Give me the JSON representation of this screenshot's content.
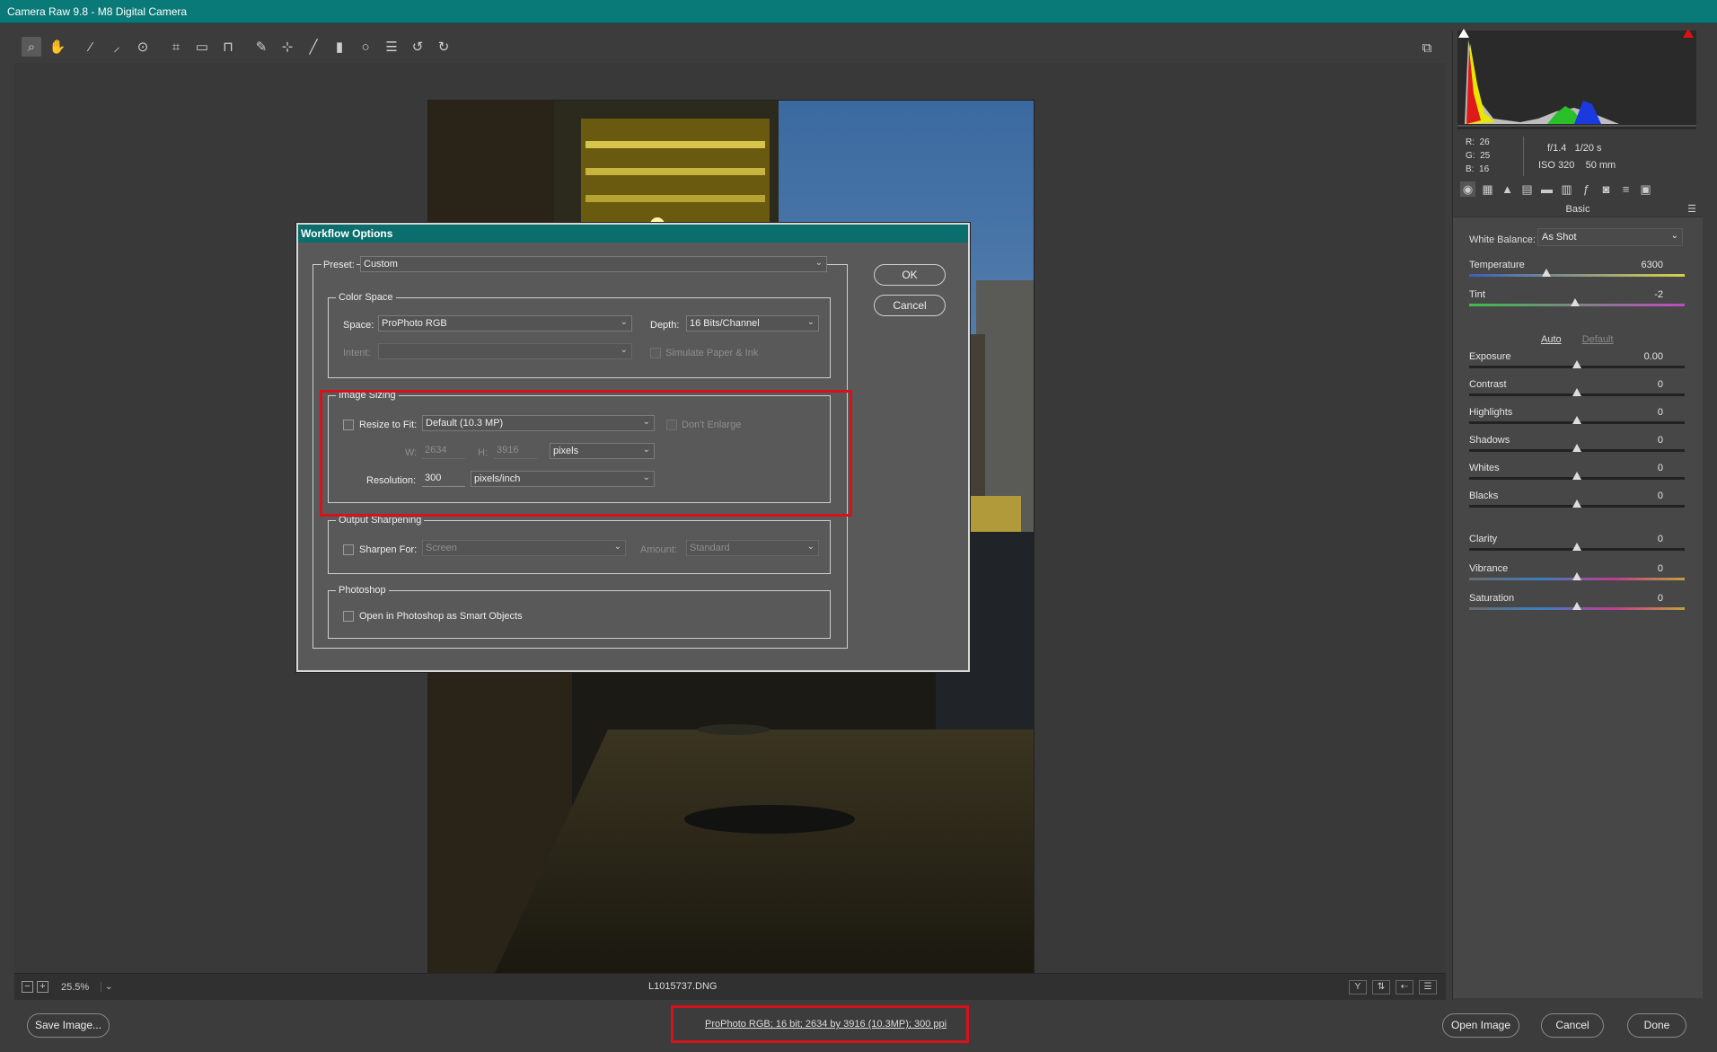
{
  "window": {
    "title": "Camera Raw 9.8  -  M8 Digital Camera"
  },
  "toolbar": {
    "tools": [
      "zoom-icon",
      "hand-icon",
      "white-balance-icon",
      "color-sampler-icon",
      "targeted-adjustment-icon",
      "crop-icon",
      "straighten-icon",
      "transform-icon",
      "spot-removal-icon",
      "red-eye-icon",
      "adjustment-brush-icon",
      "graduated-filter-icon",
      "radial-filter-icon",
      "preferences-icon",
      "rotate-left-icon",
      "rotate-right-icon"
    ]
  },
  "status": {
    "zoom_out": "−",
    "zoom_in": "+",
    "zoom_level": "25.5%",
    "zoom_dropdown": "⌄",
    "filename": "L1015737.DNG",
    "view_before_after": "Y"
  },
  "histogram": {
    "r_label": "R:",
    "r": "26",
    "g_label": "G:",
    "g": "25",
    "b_label": "B:",
    "b": "16",
    "aperture": "f/1.4",
    "shutter": "1/20 s",
    "iso": "ISO 320",
    "focal": "50 mm"
  },
  "panel": {
    "title": "Basic",
    "white_balance_label": "White Balance:",
    "white_balance_value": "As Shot",
    "auto_label": "Auto",
    "default_label": "Default",
    "sliders": {
      "temperature": {
        "label": "Temperature",
        "value": "6300",
        "pos": 0.36
      },
      "tint": {
        "label": "Tint",
        "value": "-2",
        "pos": 0.49
      },
      "exposure": {
        "label": "Exposure",
        "value": "0.00",
        "pos": 0.5
      },
      "contrast": {
        "label": "Contrast",
        "value": "0",
        "pos": 0.5
      },
      "highlights": {
        "label": "Highlights",
        "value": "0",
        "pos": 0.5
      },
      "shadows": {
        "label": "Shadows",
        "value": "0",
        "pos": 0.5
      },
      "whites": {
        "label": "Whites",
        "value": "0",
        "pos": 0.5
      },
      "blacks": {
        "label": "Blacks",
        "value": "0",
        "pos": 0.5
      },
      "clarity": {
        "label": "Clarity",
        "value": "0",
        "pos": 0.5
      },
      "vibrance": {
        "label": "Vibrance",
        "value": "0",
        "pos": 0.5
      },
      "saturation": {
        "label": "Saturation",
        "value": "0",
        "pos": 0.5
      }
    }
  },
  "dialog": {
    "title": "Workflow Options",
    "preset_label": "Preset:",
    "preset_value": "Custom",
    "ok": "OK",
    "cancel": "Cancel",
    "color_space": {
      "legend": "Color Space",
      "space_label": "Space:",
      "space_value": "ProPhoto RGB",
      "depth_label": "Depth:",
      "depth_value": "16 Bits/Channel",
      "intent_label": "Intent:",
      "simulate_label": "Simulate Paper & Ink"
    },
    "image_sizing": {
      "legend": "Image Sizing",
      "resize_label": "Resize to Fit:",
      "resize_value": "Default  (10.3 MP)",
      "dont_enlarge_label": "Don't Enlarge",
      "w_label": "W:",
      "w_value": "2634",
      "h_label": "H:",
      "h_value": "3916",
      "unit_value": "pixels",
      "resolution_label": "Resolution:",
      "resolution_value": "300",
      "resolution_unit": "pixels/inch"
    },
    "output_sharpening": {
      "legend": "Output Sharpening",
      "sharpen_label": "Sharpen For:",
      "sharpen_value": "Screen",
      "amount_label": "Amount:",
      "amount_value": "Standard"
    },
    "photoshop": {
      "legend": "Photoshop",
      "smart_objects_label": "Open in Photoshop as Smart Objects"
    }
  },
  "bottom": {
    "save_image": "Save Image...",
    "workflow_link": "ProPhoto RGB; 16 bit; 2634 by 3916 (10.3MP); 300 ppi",
    "open_image": "Open Image",
    "cancel": "Cancel",
    "done": "Done"
  },
  "colors": {
    "title_bar": "#0a7a78",
    "highlight_box": "#d6121c"
  }
}
